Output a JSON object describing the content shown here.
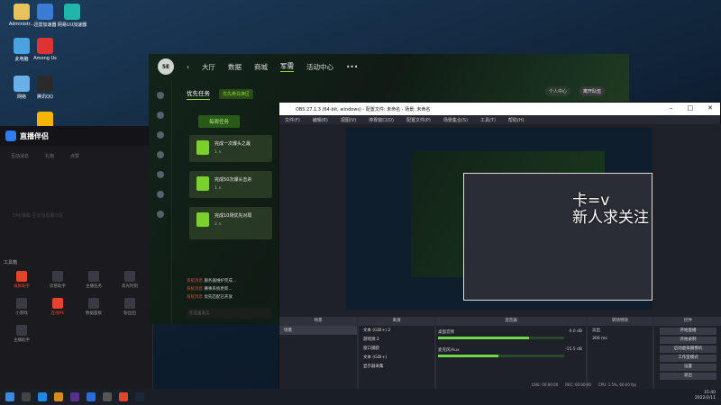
{
  "desktop": {
    "icons": [
      {
        "label": "Administr...",
        "color": "#e8c25a"
      },
      {
        "label": "迅雷加速器",
        "color": "#3a7bd5"
      },
      {
        "label": "网易UU加速器",
        "color": "#1fb5a8"
      },
      {
        "label": "此电脑",
        "color": "#4aa3e0"
      },
      {
        "label": "Among Us",
        "color": "#d33"
      },
      {
        "label": "网络",
        "color": "#6ab0e8"
      },
      {
        "label": "腾讯QQ",
        "color": "#2a2a2a"
      },
      {
        "label": "Rockstar",
        "color": "#f5b400"
      }
    ]
  },
  "live": {
    "app_name": "直播伴侣",
    "tabs": [
      "互动消息",
      "礼物",
      "点赞"
    ],
    "placeholder": "DM/弹幕 互动消息展示区",
    "tools_title": "工具箱",
    "tools": [
      "录屏助手",
      "房管助手",
      "主播任务",
      "高光时刻",
      "小游戏",
      "连线PK",
      "数据面板",
      "粉丝团",
      "主播助手"
    ]
  },
  "game": {
    "logo": "5E",
    "nav": [
      "大厅",
      "数据",
      "商城",
      "军需",
      "活动中心",
      "•••"
    ],
    "active_nav": "军需",
    "subtab": "优先任务",
    "subtab_badge": "优先券兑换区",
    "pill": "每周任务",
    "tasks": [
      {
        "title": "完成一次爆头之最",
        "reward": "1 ×"
      },
      {
        "title": "完成50次爆头击杀",
        "reward": "1 ×"
      },
      {
        "title": "完成10场优先对局",
        "reward": "2 ×"
      }
    ],
    "news": [
      {
        "tag": "系统消息",
        "text": "服务器维护完成..."
      },
      {
        "tag": "系统消息",
        "text": "赛事系统更新..."
      },
      {
        "tag": "系统消息",
        "text": "优先匹配已开放"
      }
    ],
    "input_placeholder": "在这里发言",
    "right_btns": [
      "个人中心",
      "离开队伍"
    ]
  },
  "obs": {
    "title": "OBS 27.1.3 (64-bit, windows) - 配置文件: 未命名 - 场景: 未命名",
    "menu": [
      "文件(F)",
      "编辑(E)",
      "视图(V)",
      "停靠窗口(D)",
      "配置文件(P)",
      "场景集合(S)",
      "工具(T)",
      "帮助(H)"
    ],
    "overlay_line1": "卡=v",
    "overlay_line2": "新人求关注",
    "docks": {
      "scenes": {
        "header": "场景",
        "items": [
          "场景"
        ]
      },
      "sources": {
        "header": "来源",
        "items": [
          "文本 (GDI+) 2",
          "游戏源 2",
          "窗口捕获",
          "文本 (GDI+)",
          "显示器采集"
        ]
      },
      "mixer": {
        "header": "混音器",
        "channels": [
          {
            "name": "桌面音频",
            "db": "0.0 dB",
            "level": 0.72
          },
          {
            "name": "麦克风/Aux",
            "db": "-15.5 dB",
            "level": 0.48
          }
        ]
      },
      "transitions": {
        "header": "转场特效",
        "mode": "淡出",
        "duration": "300 ms"
      },
      "controls": {
        "header": "控件",
        "buttons": [
          "开始直播",
          "开始录制",
          "启动虚拟摄像机",
          "工作室模式",
          "设置",
          "退出"
        ]
      }
    },
    "status": [
      "LIVE: 00:00:00",
      "REC: 00:00:00",
      "CPU: 1.5%, 60.00 fps"
    ]
  },
  "taskbar": {
    "time": "15:40",
    "date": "2022/2/11"
  }
}
